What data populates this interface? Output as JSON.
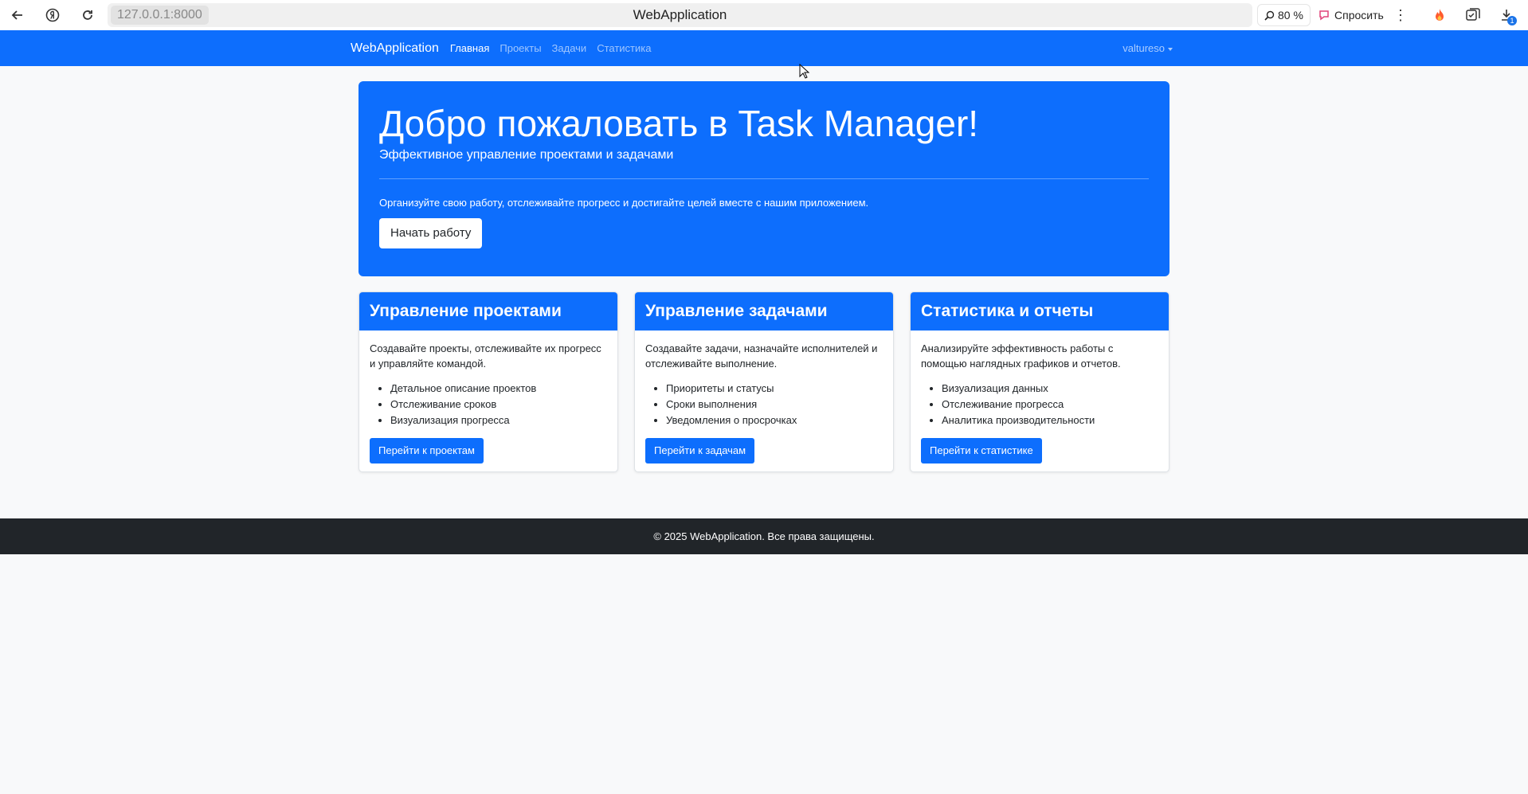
{
  "browser": {
    "url": "127.0.0.1:8000",
    "tab_title": "WebApplication",
    "zoom": "80 %",
    "ask_label": "Спросить",
    "download_badge": "1"
  },
  "navbar": {
    "brand": "WebApplication",
    "links": [
      "Главная",
      "Проекты",
      "Задачи",
      "Статистика"
    ],
    "user": "valtureso"
  },
  "hero": {
    "title": "Добро пожаловать в Task Manager!",
    "lead": "Эффективное управление проектами и задачами",
    "description": "Организуйте свою работу, отслеживайте прогресс и достигайте целей вместе с нашим приложением.",
    "button": "Начать работу"
  },
  "cards": [
    {
      "title": "Управление проектами",
      "text": "Создавайте проекты, отслеживайте их прогресс и управляйте командой.",
      "items": [
        "Детальное описание проектов",
        "Отслеживание сроков",
        "Визуализация прогресса"
      ],
      "button": "Перейти к проектам"
    },
    {
      "title": "Управление задачами",
      "text": "Создавайте задачи, назначайте исполнителей и отслеживайте выполнение.",
      "items": [
        "Приоритеты и статусы",
        "Сроки выполнения",
        "Уведомления о просрочках"
      ],
      "button": "Перейти к задачам"
    },
    {
      "title": "Статистика и отчеты",
      "text": "Анализируйте эффективность работы с помощью наглядных графиков и отчетов.",
      "items": [
        "Визуализация данных",
        "Отслеживание прогресса",
        "Аналитика производительности"
      ],
      "button": "Перейти к статистике"
    }
  ],
  "footer": {
    "text": "© 2025 WebApplication. Все права защищены."
  },
  "colors": {
    "primary": "#0d6efd",
    "footer_bg": "#212529",
    "page_bg": "#f8f9fa"
  }
}
